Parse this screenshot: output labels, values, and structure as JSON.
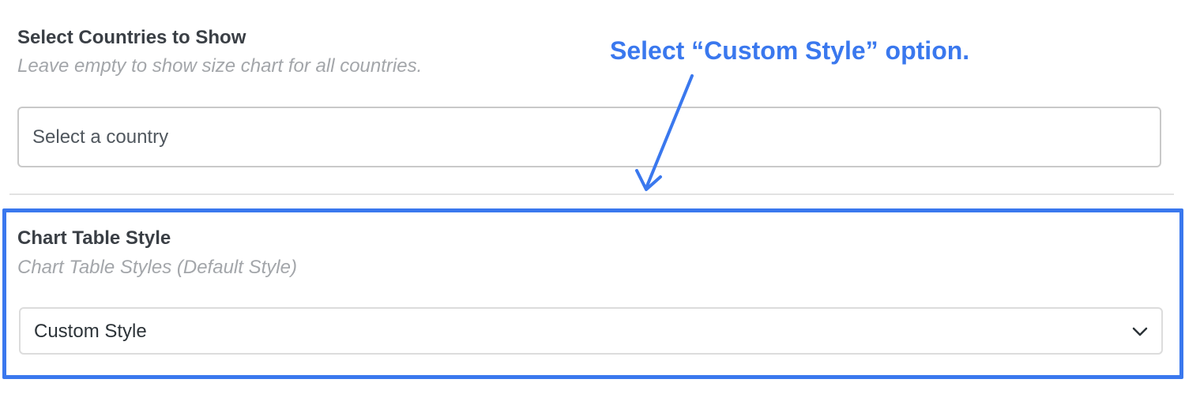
{
  "countries": {
    "label": "Select Countries to Show",
    "hint": "Leave empty to show size chart for all countries.",
    "placeholder": "Select a country"
  },
  "table_style": {
    "label": "Chart Table Style",
    "hint": "Chart Table Styles (Default Style)",
    "selected": "Custom Style",
    "chevron_icon": "chevron-down-icon"
  },
  "annotation": {
    "text": "Select “Custom Style” option.",
    "color": "#3a78ee"
  }
}
